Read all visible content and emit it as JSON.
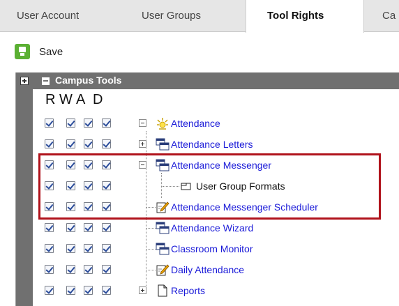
{
  "tabs": [
    {
      "label": "User Account"
    },
    {
      "label": "User Groups"
    },
    {
      "label": "Tool Rights"
    },
    {
      "label": "Ca"
    }
  ],
  "toolbar": {
    "save_label": "Save"
  },
  "panel": {
    "title": "Campus Tools"
  },
  "columns": [
    "R",
    "W",
    "A",
    "D"
  ],
  "rows": [
    {
      "label": "Attendance",
      "icon": "alert-star-icon",
      "toggle": "minus",
      "color": "#1a1ad8"
    },
    {
      "label": "Attendance Letters",
      "icon": "windows-stack-icon",
      "toggle": "plus",
      "color": "#1a1ad8"
    },
    {
      "label": "Attendance Messenger",
      "icon": "windows-stack-icon",
      "toggle": "minus",
      "color": "#1a1ad8"
    },
    {
      "label": "User Group Formats",
      "icon": "sub-window-icon",
      "toggle": "none",
      "color": "#111111"
    },
    {
      "label": "Attendance Messenger Scheduler",
      "icon": "edit-note-icon",
      "toggle": "none",
      "color": "#1a1ad8"
    },
    {
      "label": "Attendance Wizard",
      "icon": "windows-stack-icon",
      "toggle": "none",
      "color": "#1a1ad8"
    },
    {
      "label": "Classroom Monitor",
      "icon": "windows-stack-icon",
      "toggle": "none",
      "color": "#1a1ad8"
    },
    {
      "label": "Daily Attendance",
      "icon": "edit-note-icon",
      "toggle": "none",
      "color": "#1a1ad8"
    },
    {
      "label": "Reports",
      "icon": "document-icon",
      "toggle": "plus",
      "color": "#1a1ad8"
    }
  ],
  "colors": {
    "highlight": "#b0121b",
    "panel_header": "#707070",
    "link": "#1a1ad8",
    "save_green": "#5bb033"
  }
}
